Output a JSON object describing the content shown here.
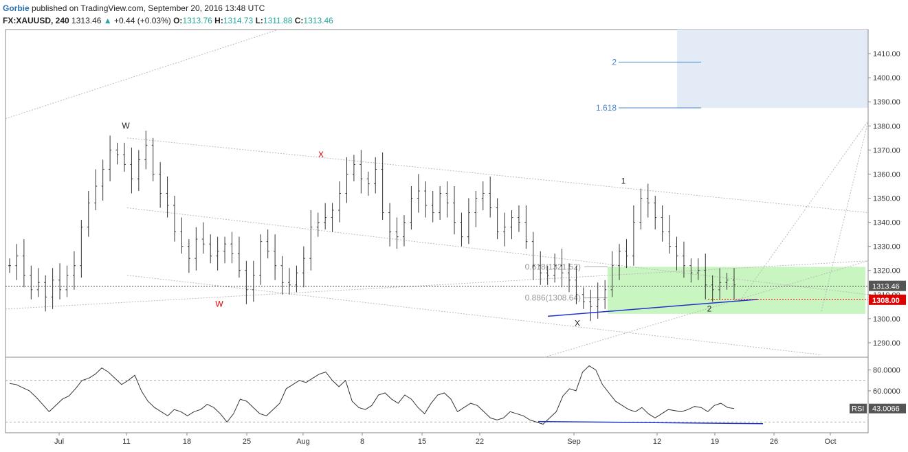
{
  "header": {
    "author": "Gorbie",
    "published_text": "published on TradingView.com, September 20, 2016 13:48 UTC",
    "symbol": "FX:XAUUSD, 240",
    "last_price": "1313.46",
    "change_arrow": "▲",
    "change": "+0.44 (+0.03%)",
    "open_label": "O:",
    "open": "1313.76",
    "high_label": "H:",
    "high": "1314.73",
    "low_label": "L:",
    "low": "1311.88",
    "close_label": "C:",
    "close": "1313.46"
  },
  "colors": {
    "candle": "#333333",
    "fib_blue": "#4a86c8",
    "target_box": "#e3ebf7",
    "zone_box": "#c8f5c0",
    "support_line": "#2233cc",
    "red_marker": "#dd0000",
    "rsi_line": "#333333"
  },
  "chart_data": {
    "type": "candlestick",
    "price_axis": {
      "ticks": [
        "1410.00",
        "1400.00",
        "1390.00",
        "1380.00",
        "1370.00",
        "1360.00",
        "1350.00",
        "1340.00",
        "1330.00",
        "1320.00",
        "1310.00",
        "1300.00",
        "1290.00"
      ],
      "range": [
        1284,
        1420
      ]
    },
    "x_axis": {
      "ticks": [
        "Jul",
        "11",
        "18",
        "25",
        "Aug",
        "8",
        "15",
        "22",
        "Sep",
        "12",
        "19",
        "26",
        "Oct"
      ]
    },
    "current_price_label": "1313.46",
    "marker_price_label": "1308.00",
    "wave_labels": [
      {
        "text": "W",
        "color": "#222222"
      },
      {
        "text": "X",
        "color": "#dd0000"
      },
      {
        "text": "W",
        "color": "#dd0000"
      },
      {
        "text": "1",
        "color": "#222222"
      },
      {
        "text": "X",
        "color": "#222222"
      },
      {
        "text": "2",
        "color": "#222222"
      }
    ],
    "fib_levels": [
      {
        "label": "2",
        "price": 1406.5
      },
      {
        "label": "1.618",
        "price": 1387.5
      }
    ],
    "retracement_labels": [
      {
        "label": "0.618(1321.52)",
        "price": 1321.52
      },
      {
        "label": "0.886(1308.64)",
        "price": 1308.64
      }
    ],
    "price_series": [
      1322,
      1326,
      1318,
      1312,
      1315,
      1309,
      1316,
      1312,
      1318,
      1322,
      1338,
      1348,
      1355,
      1362,
      1370,
      1368,
      1364,
      1358,
      1366,
      1372,
      1360,
      1352,
      1347,
      1336,
      1330,
      1325,
      1333,
      1331,
      1326,
      1328,
      1331,
      1327,
      1320,
      1312,
      1318,
      1332,
      1328,
      1322,
      1315,
      1314,
      1319,
      1325,
      1338,
      1340,
      1342,
      1345,
      1352,
      1360,
      1364,
      1358,
      1356,
      1362,
      1344,
      1336,
      1334,
      1340,
      1350,
      1353,
      1347,
      1344,
      1352,
      1348,
      1340,
      1334,
      1344,
      1350,
      1352,
      1346,
      1336,
      1338,
      1342,
      1340,
      1332,
      1322,
      1319,
      1318,
      1322,
      1319,
      1316,
      1310,
      1307,
      1305,
      1308,
      1312,
      1322,
      1328,
      1326,
      1340,
      1350,
      1348,
      1342,
      1336,
      1330,
      1326,
      1322,
      1319,
      1320,
      1314,
      1312,
      1315,
      1316,
      1314
    ],
    "rsi": {
      "label": "RSI",
      "value_label": "43.0066",
      "ticks": [
        "80.0000",
        "60.0000"
      ],
      "range": [
        25,
        87
      ],
      "levels": [
        70,
        30
      ],
      "series": [
        67,
        66,
        63,
        60,
        54,
        47,
        40,
        46,
        52,
        55,
        62,
        70,
        72,
        76,
        82,
        78,
        72,
        66,
        70,
        75,
        60,
        50,
        44,
        40,
        36,
        42,
        40,
        36,
        40,
        42,
        47,
        44,
        38,
        30,
        38,
        52,
        50,
        44,
        38,
        36,
        42,
        48,
        62,
        66,
        70,
        68,
        72,
        76,
        78,
        70,
        64,
        70,
        50,
        44,
        42,
        46,
        56,
        58,
        52,
        48,
        56,
        52,
        44,
        38,
        48,
        56,
        58,
        52,
        40,
        44,
        48,
        46,
        40,
        34,
        32,
        34,
        40,
        38,
        36,
        32,
        30,
        28,
        34,
        40,
        55,
        62,
        60,
        78,
        84,
        80,
        66,
        58,
        50,
        46,
        42,
        40,
        44,
        38,
        34,
        38,
        42,
        41,
        40,
        42,
        45,
        44,
        40,
        46,
        48,
        44,
        43
      ]
    }
  }
}
